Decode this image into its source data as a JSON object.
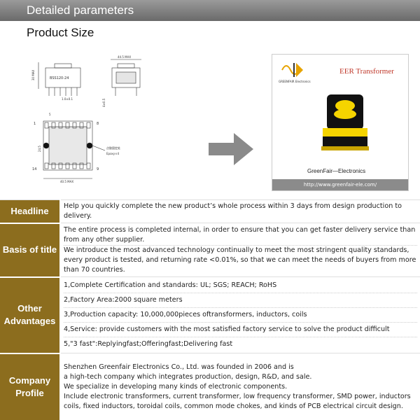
{
  "banner": {
    "title": "Detailed parameters"
  },
  "section": {
    "title": "Product Size"
  },
  "drawing": {
    "dim_top": "44.5 MAX",
    "dim_side": "30 MAX",
    "model": "BSS120-24",
    "pitch": "1.0±0.1",
    "pin_label_tl": "1",
    "pin_label_tr": "8",
    "pin_label_bl": "14",
    "pin_label_br": "9",
    "dim_pin": "5",
    "dim_width": "40.5 MAX",
    "dim_height": "24.5",
    "dim_side_small": "4±0.5",
    "note": "点胶固定处",
    "epoxy": "Epoxy×4"
  },
  "photo": {
    "logo_text": "GREENFAIR Electronics",
    "product_title": "EER Transformer",
    "brand": "GreenFair—Electronics",
    "url": "http://www.greenfair-ele.com/"
  },
  "rows": [
    {
      "label": "Headline",
      "items": [
        "Help you quickly complete the new product’s whole process within  3 days from design production to delivery."
      ]
    },
    {
      "label": "Basis of title",
      "items": [
        "The entire process is completed internal, in order to ensure that you can get faster delivery service than from any other supplier.",
        "We introduce the most advanced technology continually to meet the most stringent quality standards, every product is tested, and returning rate <0.01%, so that we can meet the needs of buyers from more than 70 countries."
      ]
    },
    {
      "label": "Other Advantages",
      "items": [
        "1,Complete Certification and standards: UL; SGS; REACH; RoHS",
        "2,Factory Area:2000 square meters",
        "3,Production capacity: 10,000,000pieces oftransformers, inductors, coils",
        "4,Service: provide customers with the most satisfied factory service to solve the product difficult",
        "5,\"3 fast\":Replyingfast;Offeringfast;Delivering fast"
      ]
    },
    {
      "label": "Company Profile",
      "items": [
        "Shenzhen Greenfair Electronics Co., Ltd. was founded in 2006 and is",
        "a high-tech company which integrates production, design, R&D, and sale.",
        "We specialize in developing many kinds of electronic components.",
        "Include electronic transformers, current transformer, low frequency transformer, SMD power, inductors coils, fixed inductors, toroidal coils, common mode chokes, and kinds of PCB electrical circuit design."
      ]
    }
  ],
  "colors": {
    "label_bg": "#8c6d1e",
    "banner_bg": "#7a7a7a",
    "accent_red": "#c0392b"
  }
}
